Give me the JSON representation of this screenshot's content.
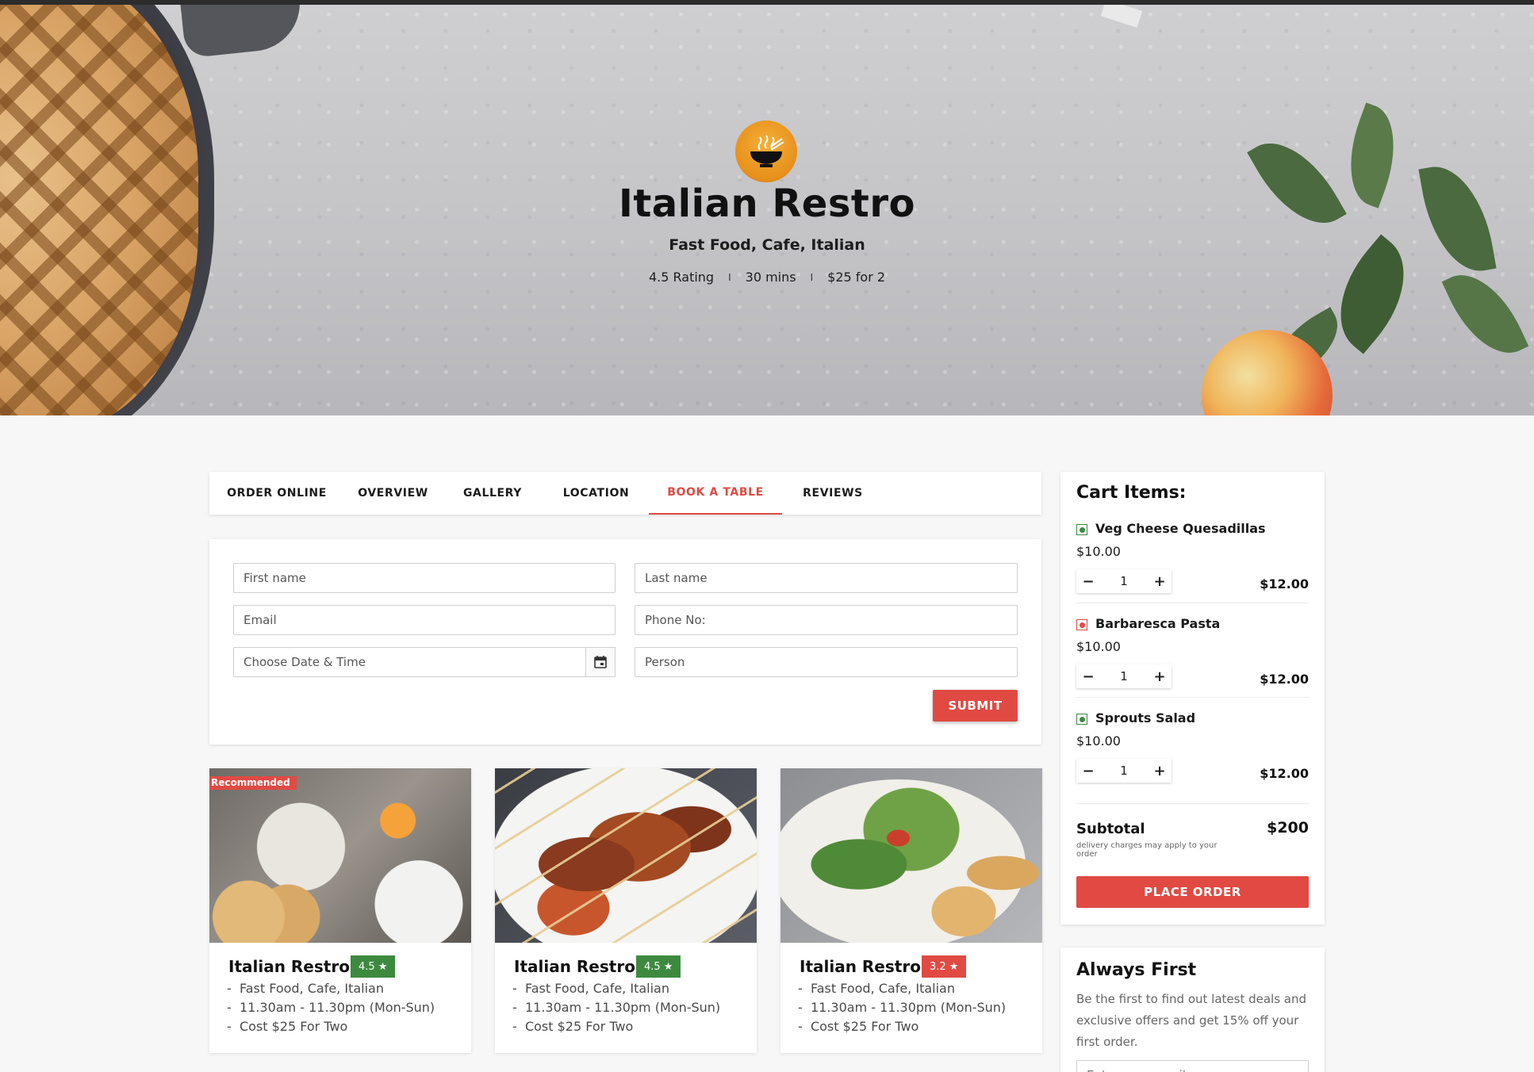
{
  "restaurant": {
    "name": "Italian Restro",
    "cuisines": "Fast Food, Cafe, Italian",
    "rating": "4.5 Rating",
    "time": "30 mins",
    "cost": "$25 for 2",
    "separator": "I"
  },
  "tabs": [
    {
      "label": "ORDER ONLINE",
      "active": false
    },
    {
      "label": "OVERVIEW",
      "active": false
    },
    {
      "label": "GALLERY",
      "active": false
    },
    {
      "label": "LOCATION",
      "active": false
    },
    {
      "label": "BOOK A TABLE",
      "active": true
    },
    {
      "label": "REVIEWS",
      "active": false
    }
  ],
  "booking_form": {
    "first_name_placeholder": "First name",
    "last_name_placeholder": "Last name",
    "email_placeholder": "Email",
    "phone_placeholder": "Phone No:",
    "datetime_placeholder": "Choose Date & Time",
    "person_placeholder": "Person",
    "submit_label": "SUBMIT"
  },
  "restaurant_cards": [
    {
      "badge": "Recommended",
      "name": "Italian Restro",
      "rating": "4.5",
      "rating_color": "#3d8a3f",
      "cuisines": "Fast Food, Cafe, Italian",
      "hours": "11.30am - 11.30pm (Mon-Sun)",
      "cost": "Cost $25 For Two",
      "bullet": "-"
    },
    {
      "badge": "",
      "name": "Italian Restro",
      "rating": "4.5",
      "rating_color": "#3d8a3f",
      "cuisines": "Fast Food, Cafe, Italian",
      "hours": "11.30am - 11.30pm (Mon-Sun)",
      "cost": "Cost $25 For Two",
      "bullet": "-"
    },
    {
      "badge": "",
      "name": "Italian Restro",
      "rating": "3.2",
      "rating_color": "#e04a43",
      "cuisines": "Fast Food, Cafe, Italian",
      "hours": "11.30am - 11.30pm (Mon-Sun)",
      "cost": "Cost $25 For Two",
      "bullet": "-"
    }
  ],
  "cart": {
    "title": "Cart Items:",
    "items": [
      {
        "name": "Veg Cheese Quesadillas",
        "type": "veg",
        "price": "$10.00",
        "qty": "1",
        "total": "$12.00"
      },
      {
        "name": "Barbaresca Pasta",
        "type": "non-veg",
        "price": "$10.00",
        "qty": "1",
        "total": "$12.00"
      },
      {
        "name": "Sprouts Salad",
        "type": "veg",
        "price": "$10.00",
        "qty": "1",
        "total": "$12.00"
      }
    ],
    "decrement_label": "−",
    "increment_label": "+",
    "subtotal_label": "Subtotal",
    "subtotal_value": "$200",
    "subtotal_note": "delivery charges may apply to your order",
    "place_order_label": "PLACE ORDER"
  },
  "newsletter": {
    "title": "Always First",
    "text": "Be the first to find out latest deals and exclusive offers and get 15% off your first order.",
    "email_placeholder": "Enter your email"
  },
  "colors": {
    "accent": "#e04a43",
    "veg": "#3d8a3f",
    "logo": "#e7901b"
  }
}
